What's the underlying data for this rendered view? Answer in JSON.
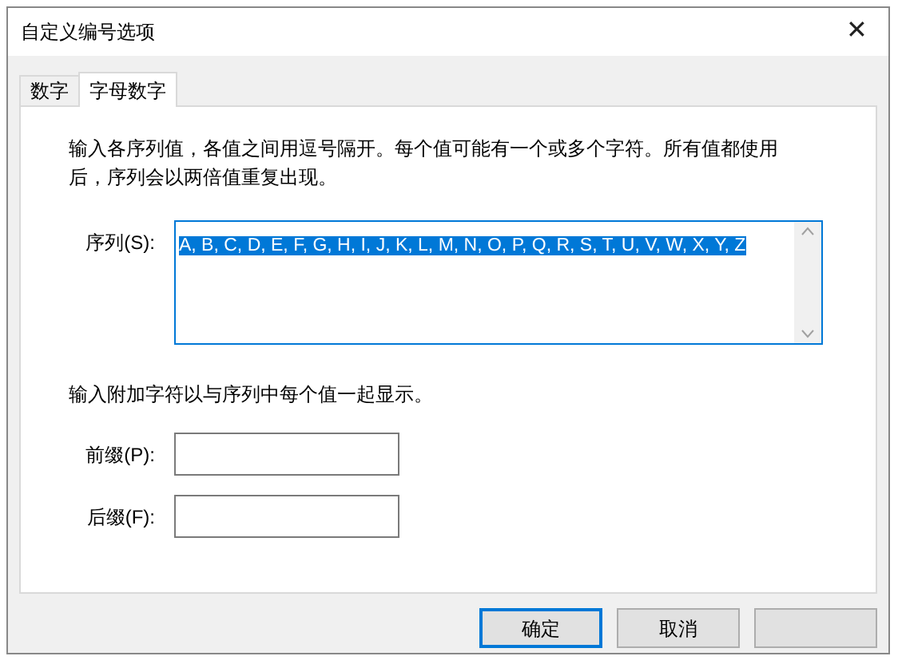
{
  "window": {
    "title": "自定义编号选项",
    "close": "✕"
  },
  "tabs": [
    {
      "label": "数字",
      "selected": false
    },
    {
      "label": "字母数字",
      "selected": true
    }
  ],
  "description": "输入各序列值，各值之间用逗号隔开。每个值可能有一个或多个字符。所有值都使用后，序列会以两倍值重复出现。",
  "sequence": {
    "label": "序列(S):",
    "value": "A, B, C, D, E, F, G, H, I, J, K, L, M, N, O, P, Q, R, S, T, U, V, W, X, Y, Z",
    "selected": true
  },
  "affix_hint": "输入附加字符以与序列中每个值一起显示。",
  "fields": [
    {
      "label": "前缀(P):"
    },
    {
      "label": "后缀(F):"
    }
  ],
  "buttons": [
    {
      "label": "确定",
      "default": true
    },
    {
      "label": "取消",
      "default": false
    },
    {
      "default": false
    }
  ]
}
